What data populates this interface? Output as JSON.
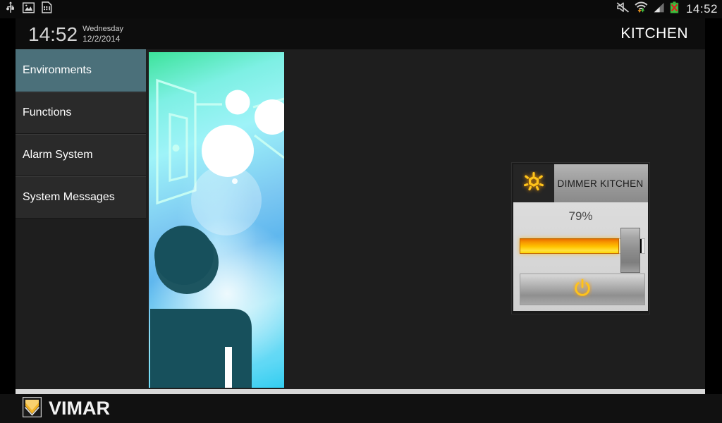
{
  "status_bar": {
    "left_icons": [
      "usb-icon",
      "image-icon",
      "sim-card-icon"
    ],
    "right_icons": [
      "mute-icon",
      "wifi-icon",
      "signal-icon",
      "battery-error-icon"
    ],
    "clock": "14:52"
  },
  "header": {
    "time": "14:52",
    "weekday": "Wednesday",
    "date": "12/2/2014",
    "room": "KITCHEN"
  },
  "sidebar": {
    "items": [
      {
        "label": "Environments",
        "selected": true
      },
      {
        "label": "Functions",
        "selected": false
      },
      {
        "label": "Alarm System",
        "selected": false
      },
      {
        "label": "System Messages",
        "selected": false
      }
    ]
  },
  "environment_image": {
    "alt": "environment-illustration",
    "description": "room with door, lights and person silhouette"
  },
  "dimmer_widget": {
    "icon": "brightness-sun-icon",
    "title": "DIMMER KITCHEN",
    "value_label": "79%",
    "value_percent": 79,
    "power_icon": "power-icon"
  },
  "footer": {
    "brand": "VIMAR",
    "logo_icon": "vimar-shield-icon"
  },
  "colors": {
    "accent_orange": "#ffc400",
    "selected_menu": "#4b707a",
    "panel_bg": "#1e1e1e",
    "widget_face": "#d6d6d6"
  }
}
